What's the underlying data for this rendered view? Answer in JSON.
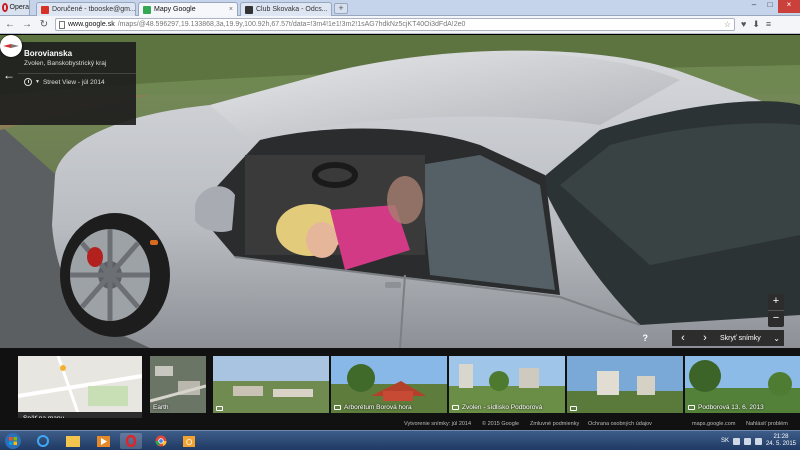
{
  "browser": {
    "opera_label": "Opera",
    "tabs": [
      {
        "label": "Doručené - tbooske@gm...",
        "favicon_color": "#d93025"
      },
      {
        "label": "Mapy Google",
        "favicon_color": "#34a853"
      },
      {
        "label": "Club Skovaka - Odcs...",
        "favicon_color": "#333333"
      }
    ],
    "url_host": "www.google.sk",
    "url_rest": "/maps/@48.596297,19.133868,3a,19.9y,100.92h,67.57t/data=!3m4!1e1!3m2!1sAG7hdkNz5cjKT40Oi3dFdA!2e0"
  },
  "streetview": {
    "place_title": "Borovianska",
    "place_subtitle": "Zvolen, Banskobystrický kraj",
    "date_label": "Street View - júl 2014",
    "hide_label": "Skryť snímky",
    "help": "?"
  },
  "filmstrip": {
    "back_to_map": "Späť na mapu",
    "items": [
      {
        "label": ""
      },
      {
        "label": "Earth"
      },
      {
        "label": ""
      },
      {
        "label": "Arborétum Borová hora"
      },
      {
        "label": "Zvolen - sídlisko Podborová"
      },
      {
        "label": ""
      },
      {
        "label": "Podborová 13. 6. 2013"
      }
    ]
  },
  "footer": {
    "created": "Vytvorenie snímky: júl 2014",
    "copyright": "© 2015 Google",
    "terms": "Zmluvné podmienky",
    "privacy": "Ochrana osobných údajov",
    "domain": "maps.google.com",
    "report": "Nahlásiť problém"
  },
  "taskbar": {
    "time": "21:28",
    "date": "24. 5. 2015",
    "lang": "SK"
  },
  "colors": {
    "accent": "#4285f4",
    "car_silver": "#c9ccd1",
    "opera_red": "#cc1b24"
  }
}
